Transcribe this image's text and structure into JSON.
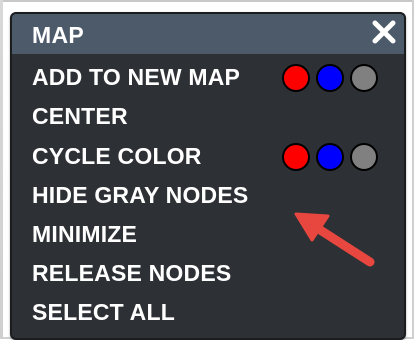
{
  "menu": {
    "title": "MAP",
    "items": [
      {
        "label": "ADD TO NEW MAP",
        "has_swatches": true
      },
      {
        "label": "CENTER",
        "has_swatches": false
      },
      {
        "label": "CYCLE COLOR",
        "has_swatches": true
      },
      {
        "label": "HIDE GRAY NODES",
        "has_swatches": false
      },
      {
        "label": "MINIMIZE",
        "has_swatches": false
      },
      {
        "label": "RELEASE NODES",
        "has_swatches": false
      },
      {
        "label": "SELECT ALL",
        "has_swatches": false
      }
    ],
    "swatch_colors": {
      "red": "#ff0000",
      "blue": "#0000ff",
      "gray": "#808080"
    }
  },
  "colors": {
    "menu_background": "#2d3034",
    "header_background": "#4d5a6a",
    "text": "#ffffff",
    "annotation_arrow": "#e8473f"
  },
  "icons": {
    "close": "close-icon",
    "annotation": "arrow-pointer-icon"
  }
}
